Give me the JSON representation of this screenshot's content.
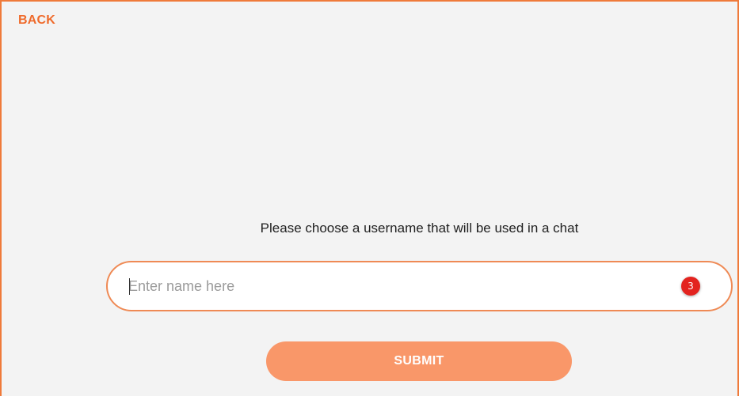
{
  "nav": {
    "back_label": "BACK"
  },
  "form": {
    "prompt": "Please choose a username that will be used in a chat",
    "username_placeholder": "Enter name here",
    "username_value": "",
    "badge_count": "3",
    "submit_label": "SUBMIT"
  },
  "colors": {
    "accent": "#ef6b2c",
    "field_border": "#ef8a55",
    "button_bg": "#f99769",
    "badge_bg": "#e3231f",
    "page_bg": "#f3f3f3"
  },
  "icons": {
    "badge": "count-badge"
  }
}
